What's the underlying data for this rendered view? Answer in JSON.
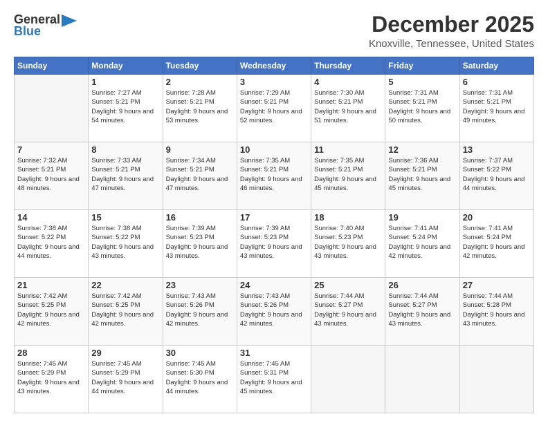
{
  "header": {
    "logo_general": "General",
    "logo_blue": "Blue",
    "month_title": "December 2025",
    "location": "Knoxville, Tennessee, United States"
  },
  "days_of_week": [
    "Sunday",
    "Monday",
    "Tuesday",
    "Wednesday",
    "Thursday",
    "Friday",
    "Saturday"
  ],
  "weeks": [
    [
      {
        "day": "",
        "sunrise": "",
        "sunset": "",
        "daylight": "",
        "empty": true
      },
      {
        "day": "1",
        "sunrise": "Sunrise: 7:27 AM",
        "sunset": "Sunset: 5:21 PM",
        "daylight": "Daylight: 9 hours and 54 minutes.",
        "empty": false
      },
      {
        "day": "2",
        "sunrise": "Sunrise: 7:28 AM",
        "sunset": "Sunset: 5:21 PM",
        "daylight": "Daylight: 9 hours and 53 minutes.",
        "empty": false
      },
      {
        "day": "3",
        "sunrise": "Sunrise: 7:29 AM",
        "sunset": "Sunset: 5:21 PM",
        "daylight": "Daylight: 9 hours and 52 minutes.",
        "empty": false
      },
      {
        "day": "4",
        "sunrise": "Sunrise: 7:30 AM",
        "sunset": "Sunset: 5:21 PM",
        "daylight": "Daylight: 9 hours and 51 minutes.",
        "empty": false
      },
      {
        "day": "5",
        "sunrise": "Sunrise: 7:31 AM",
        "sunset": "Sunset: 5:21 PM",
        "daylight": "Daylight: 9 hours and 50 minutes.",
        "empty": false
      },
      {
        "day": "6",
        "sunrise": "Sunrise: 7:31 AM",
        "sunset": "Sunset: 5:21 PM",
        "daylight": "Daylight: 9 hours and 49 minutes.",
        "empty": false
      }
    ],
    [
      {
        "day": "7",
        "sunrise": "Sunrise: 7:32 AM",
        "sunset": "Sunset: 5:21 PM",
        "daylight": "Daylight: 9 hours and 48 minutes.",
        "empty": false
      },
      {
        "day": "8",
        "sunrise": "Sunrise: 7:33 AM",
        "sunset": "Sunset: 5:21 PM",
        "daylight": "Daylight: 9 hours and 47 minutes.",
        "empty": false
      },
      {
        "day": "9",
        "sunrise": "Sunrise: 7:34 AM",
        "sunset": "Sunset: 5:21 PM",
        "daylight": "Daylight: 9 hours and 47 minutes.",
        "empty": false
      },
      {
        "day": "10",
        "sunrise": "Sunrise: 7:35 AM",
        "sunset": "Sunset: 5:21 PM",
        "daylight": "Daylight: 9 hours and 46 minutes.",
        "empty": false
      },
      {
        "day": "11",
        "sunrise": "Sunrise: 7:35 AM",
        "sunset": "Sunset: 5:21 PM",
        "daylight": "Daylight: 9 hours and 45 minutes.",
        "empty": false
      },
      {
        "day": "12",
        "sunrise": "Sunrise: 7:36 AM",
        "sunset": "Sunset: 5:21 PM",
        "daylight": "Daylight: 9 hours and 45 minutes.",
        "empty": false
      },
      {
        "day": "13",
        "sunrise": "Sunrise: 7:37 AM",
        "sunset": "Sunset: 5:22 PM",
        "daylight": "Daylight: 9 hours and 44 minutes.",
        "empty": false
      }
    ],
    [
      {
        "day": "14",
        "sunrise": "Sunrise: 7:38 AM",
        "sunset": "Sunset: 5:22 PM",
        "daylight": "Daylight: 9 hours and 44 minutes.",
        "empty": false
      },
      {
        "day": "15",
        "sunrise": "Sunrise: 7:38 AM",
        "sunset": "Sunset: 5:22 PM",
        "daylight": "Daylight: 9 hours and 43 minutes.",
        "empty": false
      },
      {
        "day": "16",
        "sunrise": "Sunrise: 7:39 AM",
        "sunset": "Sunset: 5:23 PM",
        "daylight": "Daylight: 9 hours and 43 minutes.",
        "empty": false
      },
      {
        "day": "17",
        "sunrise": "Sunrise: 7:39 AM",
        "sunset": "Sunset: 5:23 PM",
        "daylight": "Daylight: 9 hours and 43 minutes.",
        "empty": false
      },
      {
        "day": "18",
        "sunrise": "Sunrise: 7:40 AM",
        "sunset": "Sunset: 5:23 PM",
        "daylight": "Daylight: 9 hours and 43 minutes.",
        "empty": false
      },
      {
        "day": "19",
        "sunrise": "Sunrise: 7:41 AM",
        "sunset": "Sunset: 5:24 PM",
        "daylight": "Daylight: 9 hours and 42 minutes.",
        "empty": false
      },
      {
        "day": "20",
        "sunrise": "Sunrise: 7:41 AM",
        "sunset": "Sunset: 5:24 PM",
        "daylight": "Daylight: 9 hours and 42 minutes.",
        "empty": false
      }
    ],
    [
      {
        "day": "21",
        "sunrise": "Sunrise: 7:42 AM",
        "sunset": "Sunset: 5:25 PM",
        "daylight": "Daylight: 9 hours and 42 minutes.",
        "empty": false
      },
      {
        "day": "22",
        "sunrise": "Sunrise: 7:42 AM",
        "sunset": "Sunset: 5:25 PM",
        "daylight": "Daylight: 9 hours and 42 minutes.",
        "empty": false
      },
      {
        "day": "23",
        "sunrise": "Sunrise: 7:43 AM",
        "sunset": "Sunset: 5:26 PM",
        "daylight": "Daylight: 9 hours and 42 minutes.",
        "empty": false
      },
      {
        "day": "24",
        "sunrise": "Sunrise: 7:43 AM",
        "sunset": "Sunset: 5:26 PM",
        "daylight": "Daylight: 9 hours and 42 minutes.",
        "empty": false
      },
      {
        "day": "25",
        "sunrise": "Sunrise: 7:44 AM",
        "sunset": "Sunset: 5:27 PM",
        "daylight": "Daylight: 9 hours and 43 minutes.",
        "empty": false
      },
      {
        "day": "26",
        "sunrise": "Sunrise: 7:44 AM",
        "sunset": "Sunset: 5:27 PM",
        "daylight": "Daylight: 9 hours and 43 minutes.",
        "empty": false
      },
      {
        "day": "27",
        "sunrise": "Sunrise: 7:44 AM",
        "sunset": "Sunset: 5:28 PM",
        "daylight": "Daylight: 9 hours and 43 minutes.",
        "empty": false
      }
    ],
    [
      {
        "day": "28",
        "sunrise": "Sunrise: 7:45 AM",
        "sunset": "Sunset: 5:29 PM",
        "daylight": "Daylight: 9 hours and 43 minutes.",
        "empty": false
      },
      {
        "day": "29",
        "sunrise": "Sunrise: 7:45 AM",
        "sunset": "Sunset: 5:29 PM",
        "daylight": "Daylight: 9 hours and 44 minutes.",
        "empty": false
      },
      {
        "day": "30",
        "sunrise": "Sunrise: 7:45 AM",
        "sunset": "Sunset: 5:30 PM",
        "daylight": "Daylight: 9 hours and 44 minutes.",
        "empty": false
      },
      {
        "day": "31",
        "sunrise": "Sunrise: 7:45 AM",
        "sunset": "Sunset: 5:31 PM",
        "daylight": "Daylight: 9 hours and 45 minutes.",
        "empty": false
      },
      {
        "day": "",
        "sunrise": "",
        "sunset": "",
        "daylight": "",
        "empty": true
      },
      {
        "day": "",
        "sunrise": "",
        "sunset": "",
        "daylight": "",
        "empty": true
      },
      {
        "day": "",
        "sunrise": "",
        "sunset": "",
        "daylight": "",
        "empty": true
      }
    ]
  ]
}
